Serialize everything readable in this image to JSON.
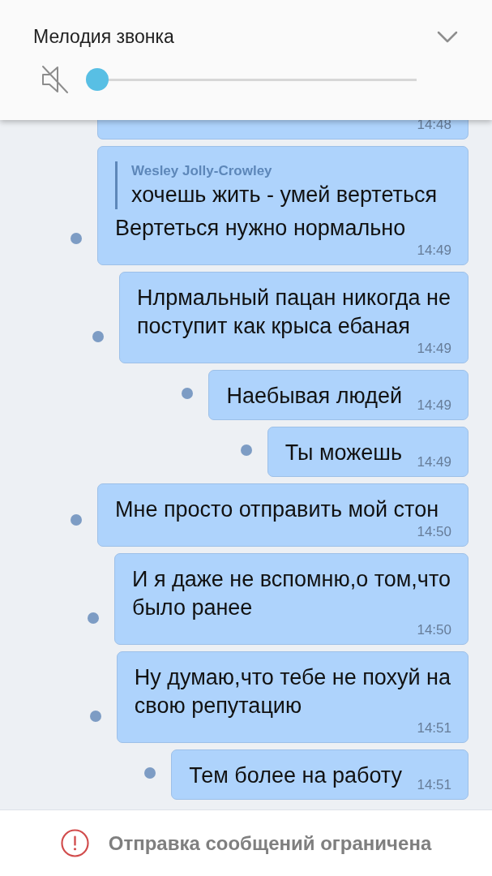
{
  "ringtone_panel": {
    "title": "Мелодия звонка",
    "muted": true,
    "level": 0
  },
  "messages": [
    {
      "kind": "clipped",
      "time": "14:48",
      "unread": false
    },
    {
      "kind": "reply",
      "quote": {
        "author": "Wesley Jolly-Crowley",
        "text": "хочешь жить - умей вертеться"
      },
      "text": "Вертеться нужно нормально",
      "time": "14:49",
      "unread": true
    },
    {
      "kind": "text",
      "text": "Нлрмальный пацан никогда не\nпоступит как крыса ебаная",
      "time": "14:49",
      "unread": true
    },
    {
      "kind": "text",
      "text": "Наебывая людей",
      "time": "14:49",
      "unread": true
    },
    {
      "kind": "text",
      "text": "Ты можешь",
      "time": "14:49",
      "unread": true
    },
    {
      "kind": "text",
      "text": "Мне просто отправить мой стон",
      "time": "14:50",
      "unread": true
    },
    {
      "kind": "text",
      "text": "И я даже не вспомню,о том,что\nбыло ранее",
      "time": "14:50",
      "unread": true
    },
    {
      "kind": "text",
      "text": "Ну думаю,что тебе не похуй на\nсвою репутацию",
      "time": "14:51",
      "unread": true
    },
    {
      "kind": "text",
      "text": "Тем более на работу",
      "time": "14:51",
      "unread": true
    }
  ],
  "notice": {
    "text": "Отправка сообщений ограничена"
  }
}
